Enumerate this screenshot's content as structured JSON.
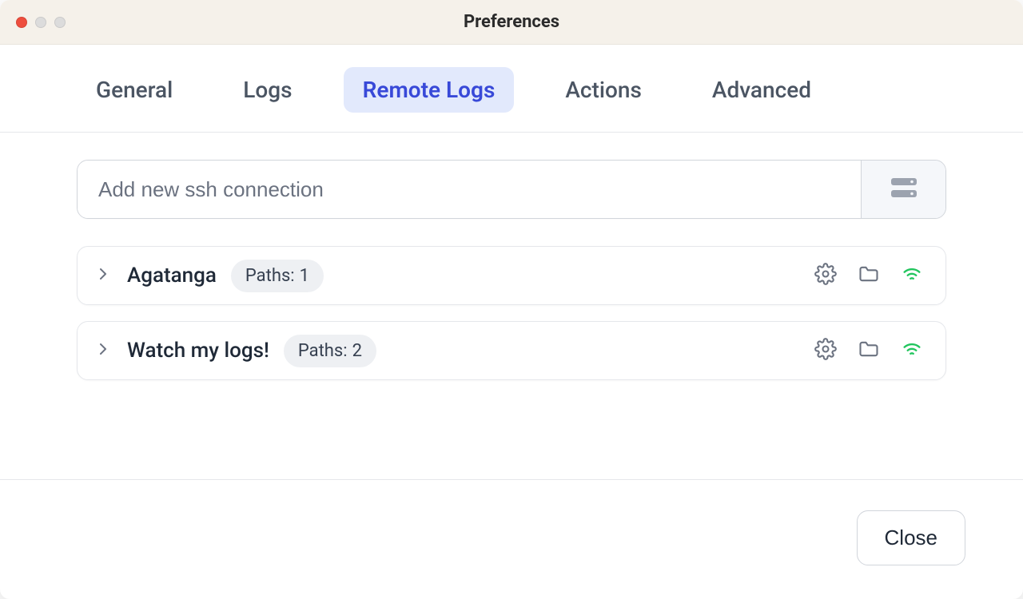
{
  "window": {
    "title": "Preferences"
  },
  "tabs": {
    "items": [
      {
        "label": "General",
        "active": false
      },
      {
        "label": "Logs",
        "active": false
      },
      {
        "label": "Remote Logs",
        "active": true
      },
      {
        "label": "Actions",
        "active": false
      },
      {
        "label": "Advanced",
        "active": false
      }
    ]
  },
  "remote_logs": {
    "add_placeholder": "Add new ssh connection",
    "connections": [
      {
        "name": "Agatanga",
        "paths_label": "Paths:",
        "paths_count": "1"
      },
      {
        "name": "Watch my logs!",
        "paths_label": "Paths:",
        "paths_count": "2"
      }
    ]
  },
  "footer": {
    "close_label": "Close"
  }
}
